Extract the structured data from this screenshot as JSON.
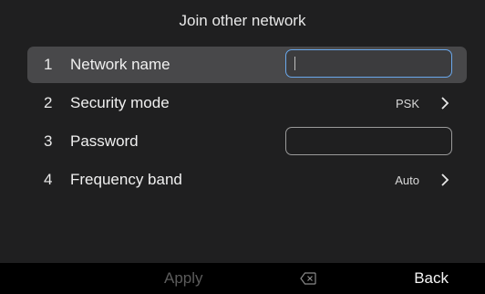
{
  "dialog": {
    "title": "Join other network"
  },
  "rows": [
    {
      "num": "1",
      "label": "Network name",
      "value": ""
    },
    {
      "num": "2",
      "label": "Security mode",
      "value": "PSK"
    },
    {
      "num": "3",
      "label": "Password",
      "value": ""
    },
    {
      "num": "4",
      "label": "Frequency band",
      "value": "Auto"
    }
  ],
  "footer": {
    "apply": "Apply",
    "back": "Back"
  },
  "icons": {
    "chevron": "chevron-right-icon",
    "delete": "backspace-icon"
  },
  "colors": {
    "focus": "#6aa8ec",
    "selected_row": "#48484a",
    "background": "#1f1f20"
  }
}
